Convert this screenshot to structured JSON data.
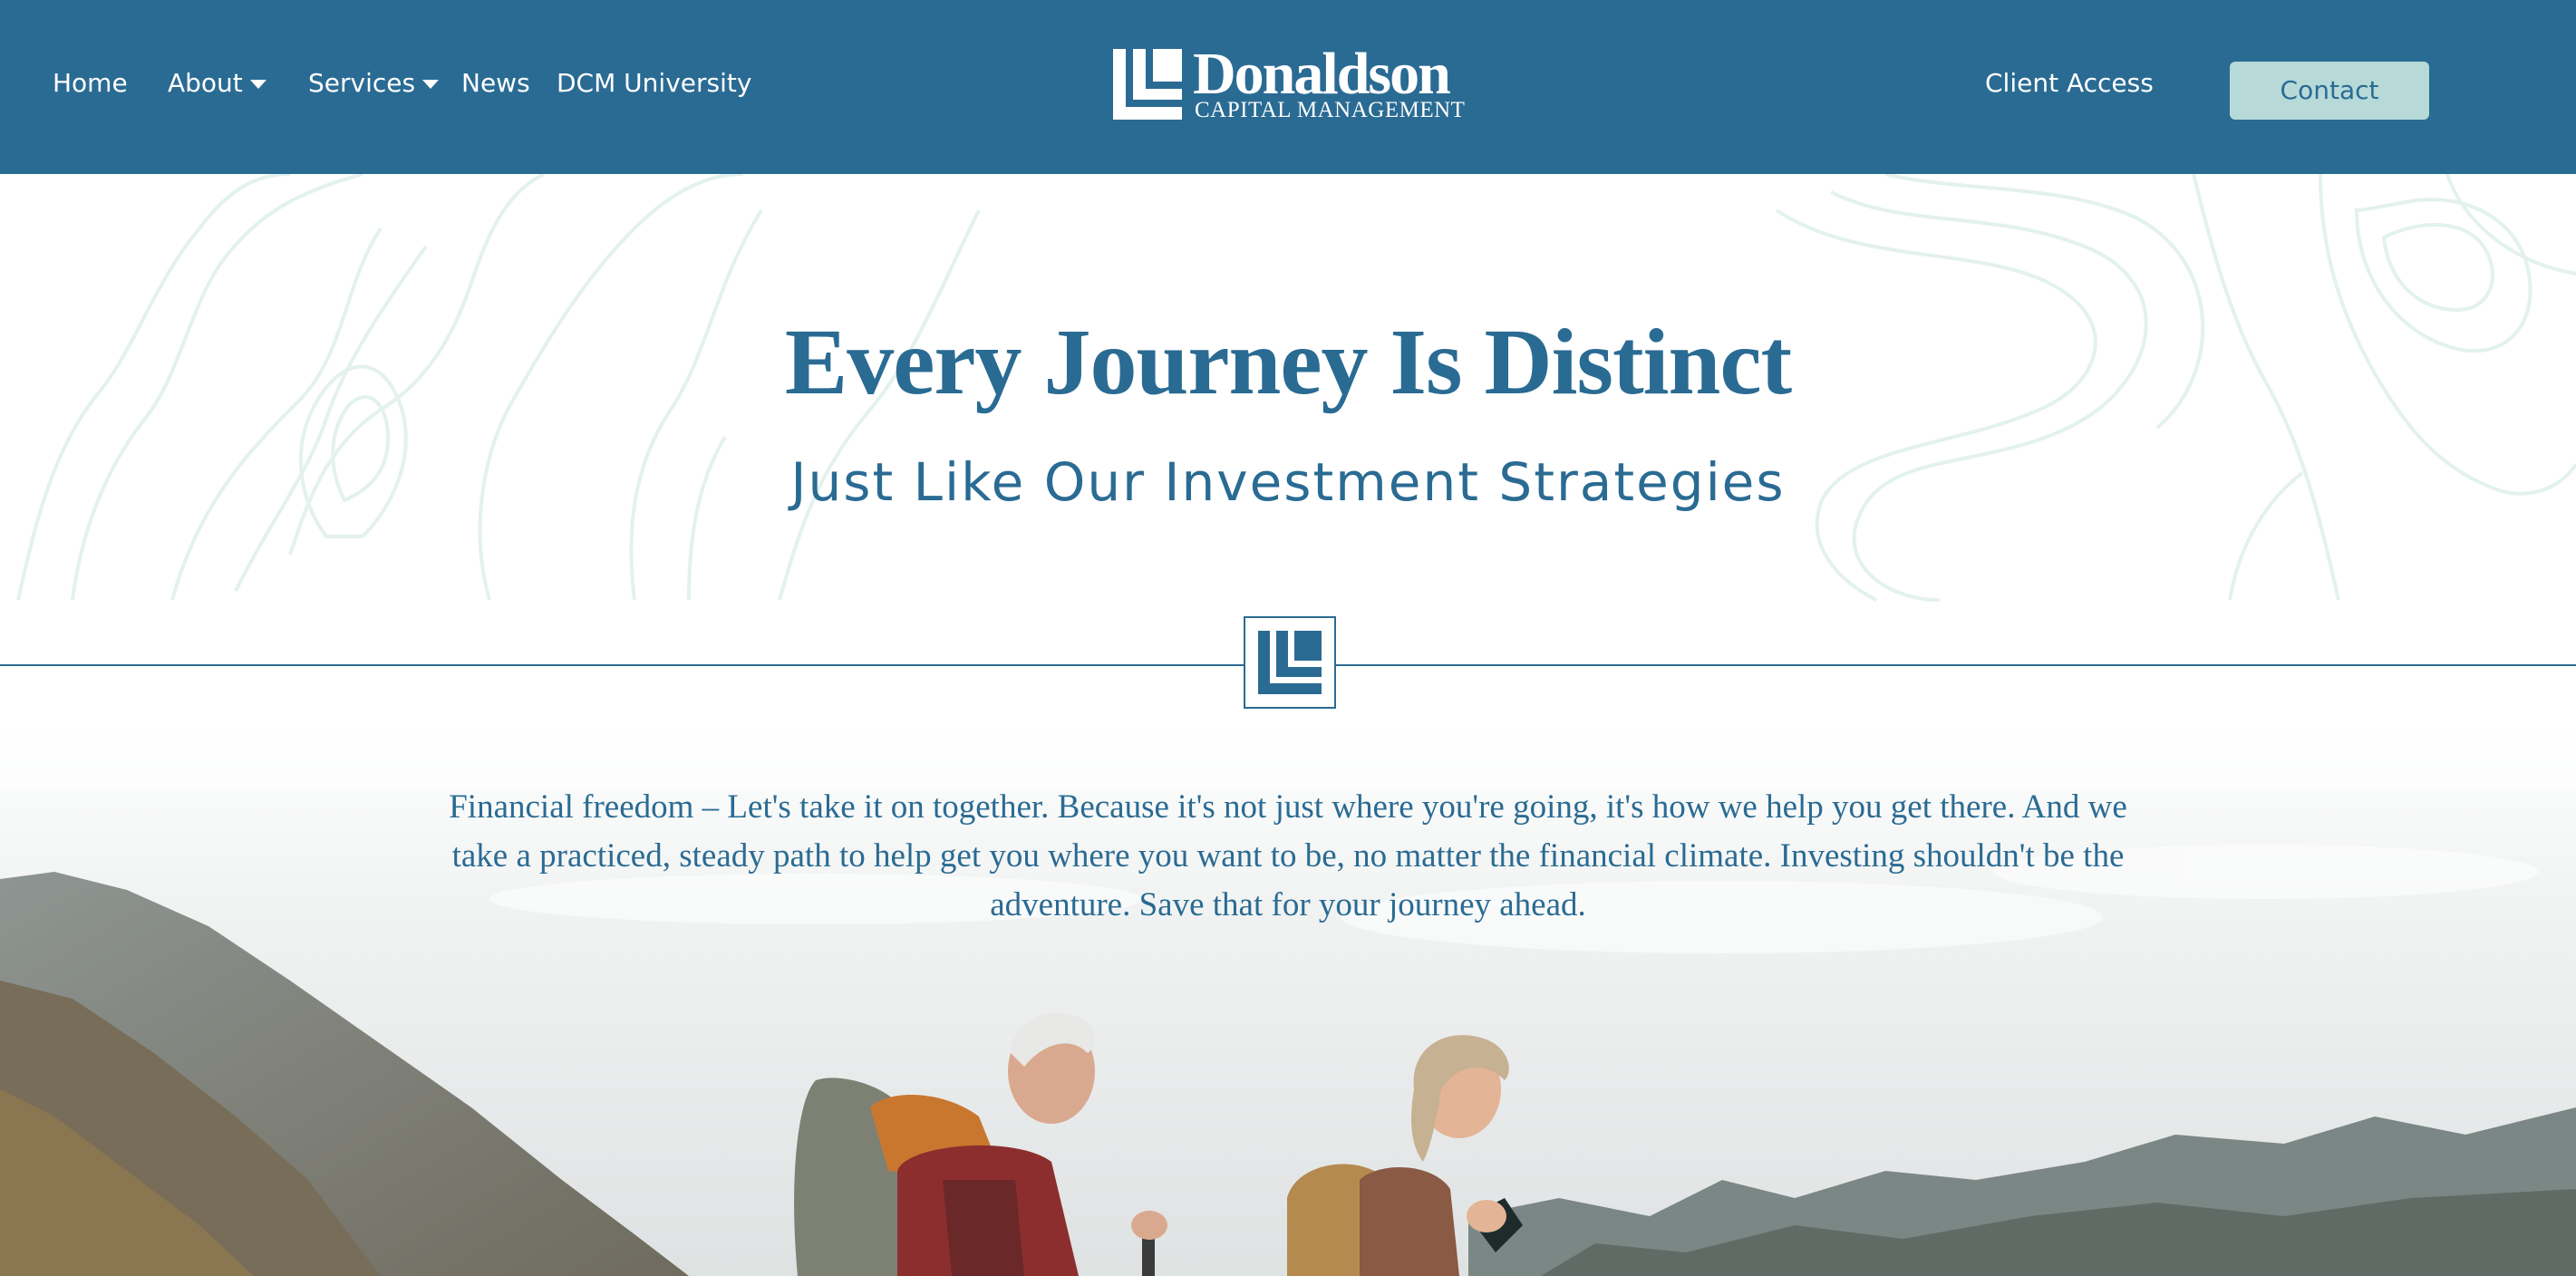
{
  "header": {
    "nav": [
      {
        "label": "Home",
        "has_dropdown": false
      },
      {
        "label": "About",
        "has_dropdown": true
      },
      {
        "label": "Services",
        "has_dropdown": true
      },
      {
        "label": "News",
        "has_dropdown": false
      },
      {
        "label": "DCM University",
        "has_dropdown": false
      }
    ],
    "logo": {
      "name": "Donaldson",
      "subtitle": "CAPITAL MANAGEMENT"
    },
    "client_access": "Client Access",
    "contact_label": "Contact"
  },
  "hero": {
    "title": "Every Journey Is Distinct",
    "subtitle": "Just Like Our Investment Strategies"
  },
  "intro": {
    "text": "Financial freedom – Let's take it on together. Because it's not just where you're going, it's how we help you get there. And we take a practiced, steady path to help get you where you want to be, no matter the financial climate. Investing shouldn't be the adventure. Save that for your journey ahead."
  },
  "colors": {
    "brand_blue": "#2a6b93",
    "contact_button": "#b7dad8",
    "topo_lines": "#e3f1ef"
  }
}
